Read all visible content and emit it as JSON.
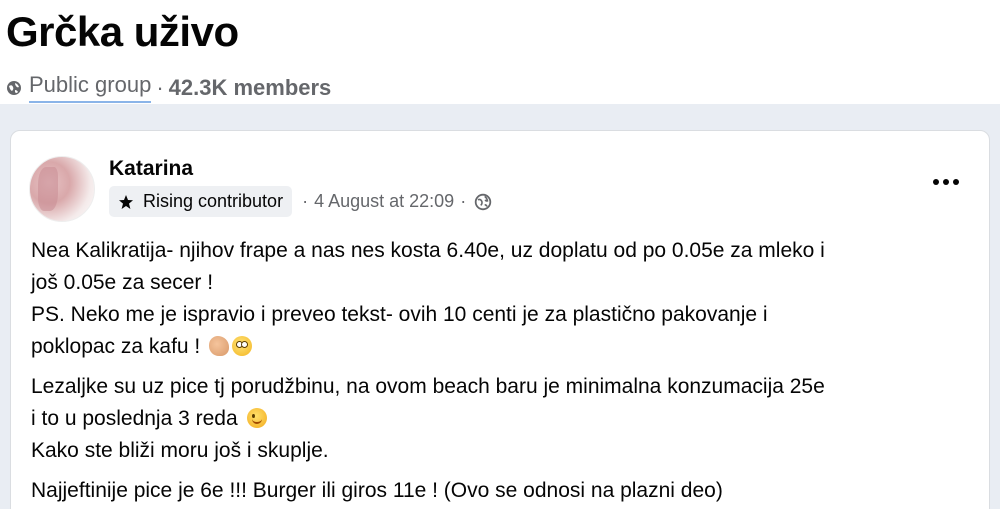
{
  "group": {
    "title": "Grčka uživo",
    "privacy_label": "Public group",
    "separator": "·",
    "members": "42.3K members",
    "privacy_icon": "globe-icon"
  },
  "post": {
    "author": "Katarina",
    "badge_label": "Rising contributor",
    "badge_icon": "star-icon",
    "meta_separator": "·",
    "timestamp": "4 August at 22:09",
    "audience_icon": "globe-icon",
    "more_icon": "more-options-icon",
    "paragraphs": [
      {
        "lines": [
          "Nea Kalikratija- njihov frape a nas nes kosta 6.40e, uz doplatu od po 0.05e za mleko i",
          "još 0.05e za secer !",
          "PS. Neko me je ispravio i preveo tekst- ovih 10 centi je za plastično pakovanje i",
          "poklopac za kafu !"
        ]
      },
      {
        "lines": [
          "Lezaljke su uz pice tj porudžbinu, na ovom beach baru je minimalna konzumacija 25e",
          "i to u poslednja 3 reda",
          "Kako ste bliži moru još i skuplje."
        ]
      },
      {
        "lines": [
          "Najjeftinije pice je 6e !!! Burger ili giros 11e ! (Ovo se odnosi na plazni deo)"
        ]
      }
    ]
  },
  "colors": {
    "text_primary": "#050505",
    "text_secondary": "#65676b",
    "feed_background": "#e9edf3",
    "badge_background": "#eef0f3",
    "link_underline": "#8ab4e8"
  }
}
